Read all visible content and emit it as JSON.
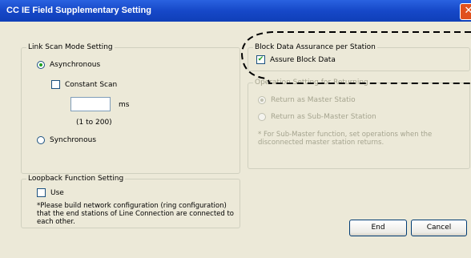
{
  "window": {
    "title": "CC IE Field Supplementary Setting",
    "close_glyph": "✕"
  },
  "link_scan": {
    "legend": "Link Scan Mode Setting",
    "asynchronous_label": "Asynchronous",
    "constant_scan_label": "Constant Scan",
    "constant_scan_value": "",
    "unit": "ms",
    "range": "(1 to 200)",
    "synchronous_label": "Synchronous"
  },
  "block_data": {
    "legend": "Block Data Assurance per Station",
    "assure_label": "Assure Block Data"
  },
  "operation": {
    "legend": "Operation Setting for Returning",
    "master_label": "Return as Master Statio",
    "submaster_label": "Return as Sub-Master Station",
    "note": "* For Sub-Master function, set operations when the disconnected master station returns."
  },
  "loopback": {
    "legend": "Loopback Function Setting",
    "use_label": "Use",
    "note": "*Please build network configuration (ring configuration) that the end stations of Line Connection are connected to each other."
  },
  "buttons": {
    "end": "End",
    "cancel": "Cancel"
  },
  "colors": {
    "title_bar": "#1648c8",
    "dialog_bg": "#ece9d8",
    "highlight_dash": "#000000"
  }
}
